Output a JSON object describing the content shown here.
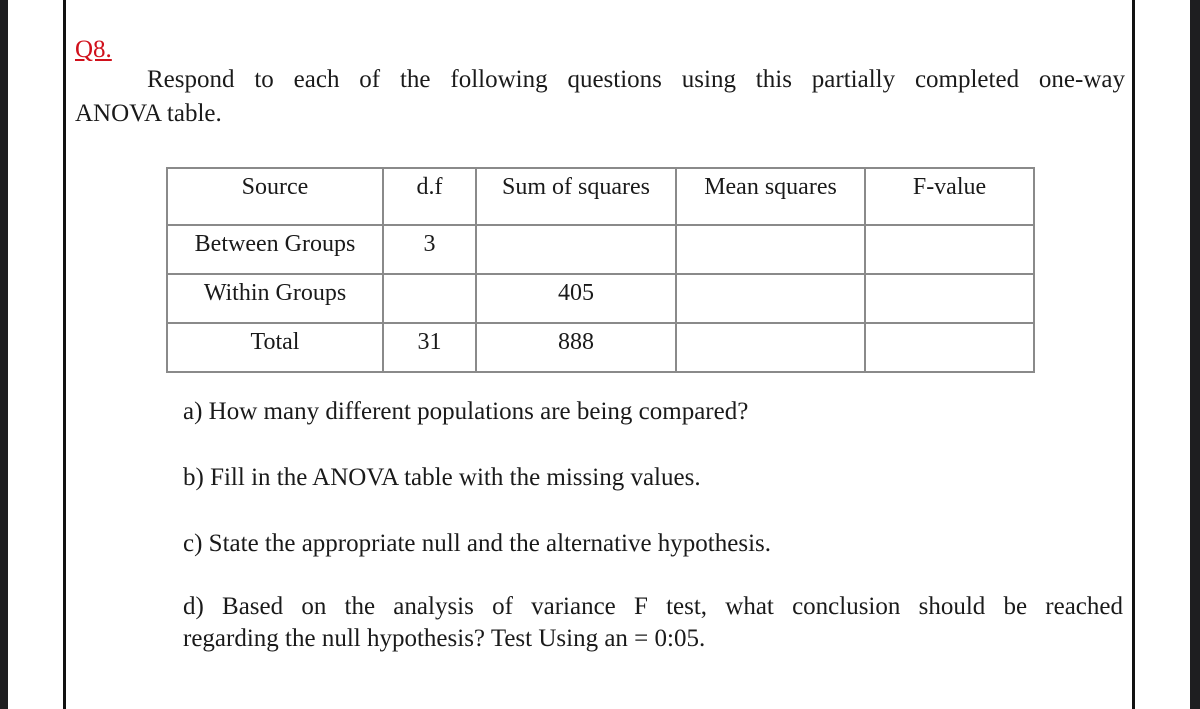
{
  "question": {
    "number": "Q8.",
    "number_color": "#d0101b",
    "intro_line1": "Respond to each of the following questions using this partially completed one-way",
    "intro_line2": "ANOVA table."
  },
  "anova_table": {
    "headers": [
      "Source",
      "d.f",
      "Sum of squares",
      "Mean squares",
      "F-value"
    ],
    "rows": [
      {
        "source": "Between Groups",
        "df": "3",
        "ss": "",
        "ms": "",
        "f": ""
      },
      {
        "source": "Within Groups",
        "df": "",
        "ss": "405",
        "ms": "",
        "f": ""
      },
      {
        "source": "Total",
        "df": "31",
        "ss": "888",
        "ms": "",
        "f": ""
      }
    ]
  },
  "parts": {
    "a": "a) How many different populations are being compared?",
    "b": "b) Fill in the ANOVA table with the missing values.",
    "c": "c) State the appropriate null and the alternative hypothesis.",
    "d_line1": "d) Based on the analysis of variance F test, what conclusion should be reached",
    "d_line2": "regarding the null hypothesis? Test Using an = 0:05."
  }
}
